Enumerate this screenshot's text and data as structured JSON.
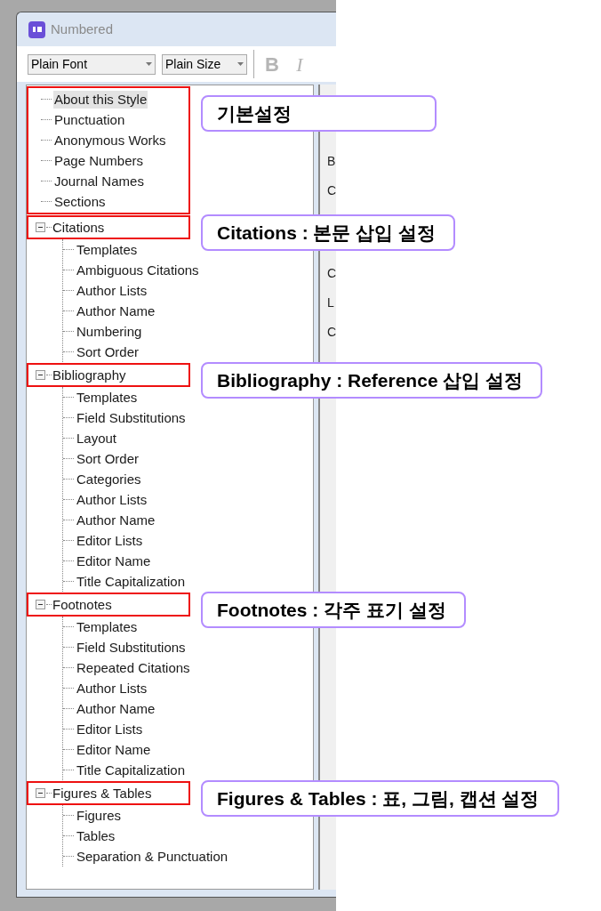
{
  "window": {
    "title": "Numbered"
  },
  "toolbar": {
    "font": "Plain Font",
    "size": "Plain Size",
    "bold": "B",
    "italic": "I"
  },
  "sections": [
    {
      "callout": "기본설정",
      "items": [
        {
          "label": "About this Style",
          "selected": true
        },
        {
          "label": "Punctuation",
          "selected": false
        },
        {
          "label": "Anonymous Works",
          "selected": false
        },
        {
          "label": "Page Numbers",
          "selected": false
        },
        {
          "label": "Journal Names",
          "selected": false
        },
        {
          "label": "Sections",
          "selected": false
        }
      ]
    },
    {
      "callout": "Citations : 본문 삽입 설정",
      "node": {
        "label": "Citations",
        "selected": false,
        "expanded": true,
        "children": [
          {
            "label": "Templates",
            "selected": false
          },
          {
            "label": "Ambiguous Citations",
            "selected": false
          },
          {
            "label": "Author Lists",
            "selected": false
          },
          {
            "label": "Author Name",
            "selected": false
          },
          {
            "label": "Numbering",
            "selected": false
          },
          {
            "label": "Sort Order",
            "selected": false
          }
        ]
      }
    },
    {
      "callout": "Bibliography : Reference 삽입 설정",
      "node": {
        "label": "Bibliography",
        "selected": false,
        "expanded": true,
        "children": [
          {
            "label": "Templates",
            "selected": false
          },
          {
            "label": "Field Substitutions",
            "selected": false
          },
          {
            "label": "Layout",
            "selected": false
          },
          {
            "label": "Sort Order",
            "selected": false
          },
          {
            "label": "Categories",
            "selected": false
          },
          {
            "label": "Author Lists",
            "selected": false
          },
          {
            "label": "Author Name",
            "selected": false
          },
          {
            "label": "Editor Lists",
            "selected": false
          },
          {
            "label": "Editor Name",
            "selected": false
          },
          {
            "label": "Title Capitalization",
            "selected": false
          }
        ]
      }
    },
    {
      "callout": "Footnotes : 각주 표기 설정",
      "node": {
        "label": "Footnotes",
        "selected": false,
        "expanded": true,
        "children": [
          {
            "label": "Templates",
            "selected": false
          },
          {
            "label": "Field Substitutions",
            "selected": false
          },
          {
            "label": "Repeated Citations",
            "selected": false
          },
          {
            "label": "Author Lists",
            "selected": false
          },
          {
            "label": "Author Name",
            "selected": false
          },
          {
            "label": "Editor Lists",
            "selected": false
          },
          {
            "label": "Editor Name",
            "selected": false
          },
          {
            "label": "Title Capitalization",
            "selected": false
          }
        ]
      }
    },
    {
      "callout": "Figures & Tables :  표, 그림, 캡션 설정",
      "node": {
        "label": "Figures & Tables",
        "selected": false,
        "expanded": true,
        "children": [
          {
            "label": "Figures",
            "selected": false
          },
          {
            "label": "Tables",
            "selected": false
          },
          {
            "label": "Separation & Punctuation",
            "selected": false
          }
        ]
      }
    }
  ],
  "right_panel": {
    "labels": [
      "B",
      "C",
      "C",
      "L",
      "C"
    ]
  }
}
